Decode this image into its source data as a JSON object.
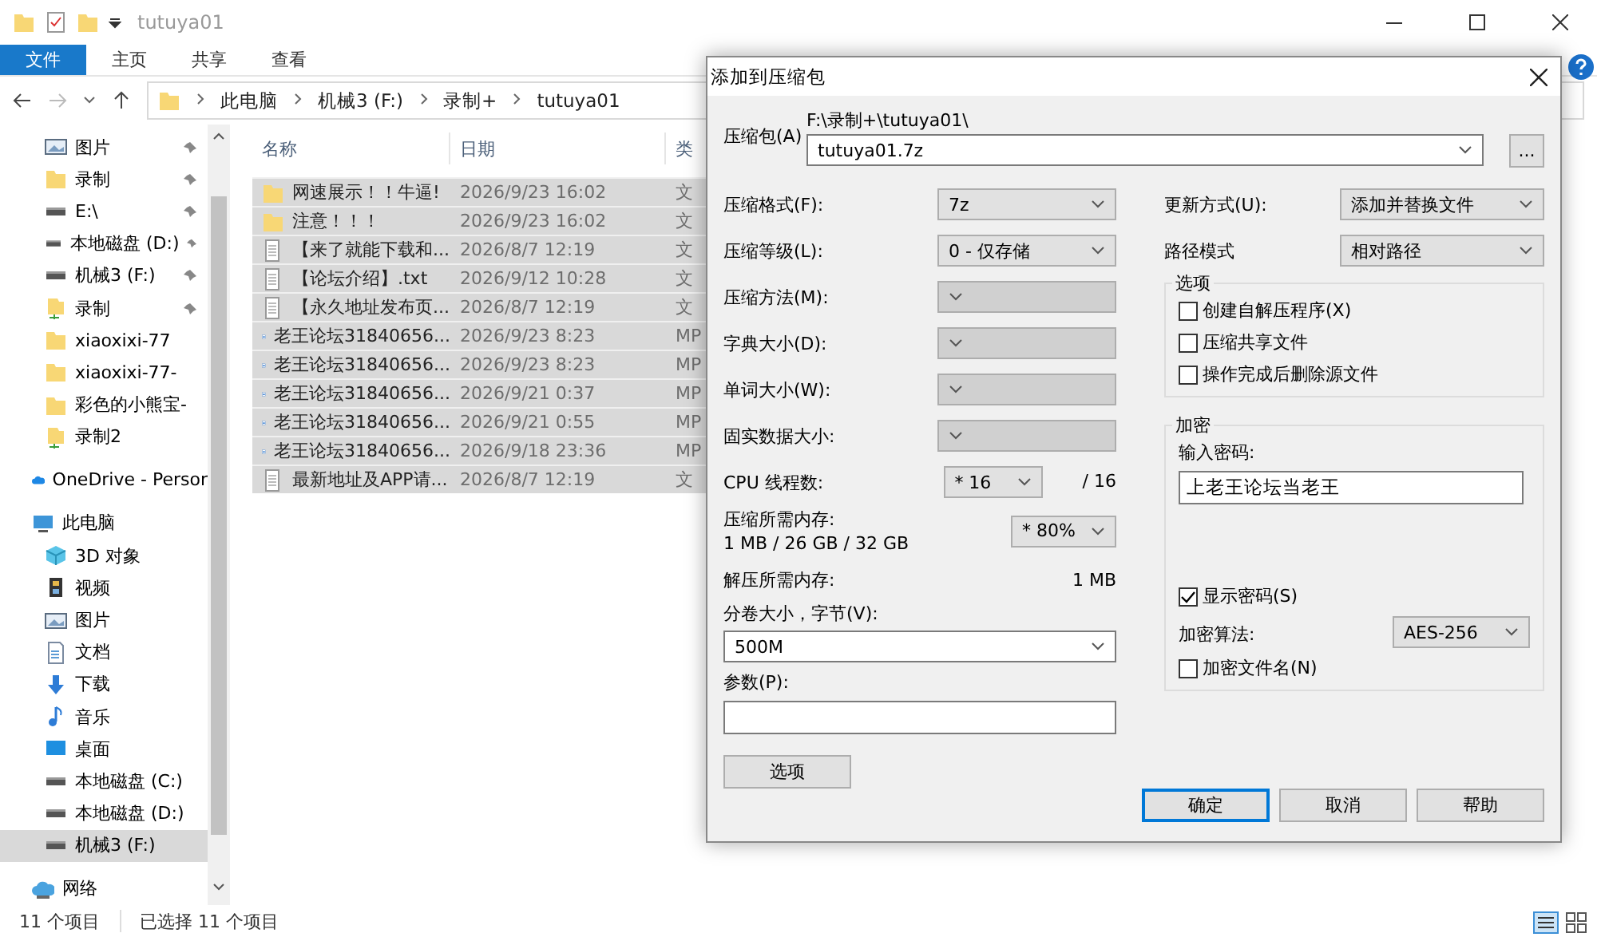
{
  "window": {
    "title": "tutuya01"
  },
  "ribbon_tabs": [
    {
      "label": "文件",
      "selected": true
    },
    {
      "label": "主页",
      "selected": false
    },
    {
      "label": "共享",
      "selected": false
    },
    {
      "label": "查看",
      "selected": false
    }
  ],
  "breadcrumb": [
    "此电脑",
    "机械3 (F:)",
    "录制+",
    "tutuya01"
  ],
  "nav_pane": {
    "quick_access": [
      {
        "label": "图片",
        "kind": "pictures",
        "pinned": true,
        "selected": false
      },
      {
        "label": "录制",
        "kind": "folder",
        "pinned": true,
        "selected": false
      },
      {
        "label": "E:\\",
        "kind": "drive",
        "pinned": true,
        "selected": false
      },
      {
        "label": "本地磁盘 (D:)",
        "kind": "drive",
        "pinned": true,
        "selected": false
      },
      {
        "label": "机械3 (F:)",
        "kind": "drive",
        "pinned": true,
        "selected": false
      },
      {
        "label": "录制",
        "kind": "share",
        "pinned": true,
        "selected": false
      },
      {
        "label": "xiaoxixi-77",
        "kind": "folder",
        "pinned": false,
        "selected": false
      },
      {
        "label": "xiaoxixi-77-",
        "kind": "folder",
        "pinned": false,
        "selected": false
      },
      {
        "label": "彩色的小熊宝-",
        "kind": "folder",
        "pinned": false,
        "selected": false
      },
      {
        "label": "录制2",
        "kind": "share",
        "pinned": false,
        "selected": false
      }
    ],
    "roots": [
      {
        "label": "OneDrive - Persor",
        "kind": "cloud",
        "selected": false
      },
      {
        "label": "此电脑",
        "kind": "pc",
        "selected": false,
        "children": [
          {
            "label": "3D 对象",
            "kind": "cube",
            "selected": false
          },
          {
            "label": "视频",
            "kind": "film",
            "selected": false
          },
          {
            "label": "图片",
            "kind": "pictures",
            "selected": false
          },
          {
            "label": "文档",
            "kind": "document",
            "selected": false
          },
          {
            "label": "下载",
            "kind": "download",
            "selected": false
          },
          {
            "label": "音乐",
            "kind": "music",
            "selected": false
          },
          {
            "label": "桌面",
            "kind": "desktop",
            "selected": false
          },
          {
            "label": "本地磁盘 (C:)",
            "kind": "drive",
            "selected": false
          },
          {
            "label": "本地磁盘 (D:)",
            "kind": "drive",
            "selected": false
          },
          {
            "label": "机械3 (F:)",
            "kind": "drive",
            "selected": true
          }
        ]
      },
      {
        "label": "网络",
        "kind": "network",
        "selected": false
      }
    ]
  },
  "file_list": {
    "columns": [
      "名称",
      "日期",
      "类"
    ],
    "rows": [
      {
        "name": "网速展示！！牛逼!",
        "date": "2026/9/23 16:02",
        "type": "文",
        "kind": "folder",
        "selected": true
      },
      {
        "name": "注意！！！",
        "date": "2026/9/23 16:02",
        "type": "文",
        "kind": "folder",
        "selected": true
      },
      {
        "name": "【来了就能下载和...",
        "date": "2026/8/7 12:19",
        "type": "文",
        "kind": "text",
        "selected": true
      },
      {
        "name": "【论坛介绍】.txt",
        "date": "2026/9/12 10:28",
        "type": "文",
        "kind": "text",
        "selected": true
      },
      {
        "name": "【永久地址发布页...",
        "date": "2026/8/7 12:19",
        "type": "文",
        "kind": "text",
        "selected": true
      },
      {
        "name": "老王论坛31840656...",
        "date": "2026/9/23 8:23",
        "type": "MP",
        "kind": "video",
        "selected": true
      },
      {
        "name": "老王论坛31840656...",
        "date": "2026/9/23 8:23",
        "type": "MP",
        "kind": "video",
        "selected": true
      },
      {
        "name": "老王论坛31840656...",
        "date": "2026/9/21 0:37",
        "type": "MP",
        "kind": "video",
        "selected": true
      },
      {
        "name": "老王论坛31840656...",
        "date": "2026/9/21 0:55",
        "type": "MP",
        "kind": "video",
        "selected": true
      },
      {
        "name": "老王论坛31840656...",
        "date": "2026/9/18 23:36",
        "type": "MP",
        "kind": "video",
        "selected": true
      },
      {
        "name": "最新地址及APP请...",
        "date": "2026/8/7 12:19",
        "type": "文",
        "kind": "text",
        "selected": true
      }
    ]
  },
  "status_bar": {
    "count": "11 个项目",
    "selection": "已选择 11 个项目"
  },
  "dialog": {
    "title": "添加到压缩包",
    "archive": {
      "label": "压缩包(A)",
      "folder": "F:\\录制+\\tutuya01\\",
      "value": "tutuya01.7z",
      "browse": "..."
    },
    "left_selects": [
      {
        "label": "压缩格式(F):",
        "value": "7z",
        "disabled": false
      },
      {
        "label": "压缩等级(L):",
        "value": "0 - 仅存储",
        "disabled": false
      },
      {
        "label": "压缩方法(M):",
        "disabled": true
      },
      {
        "label": "字典大小(D):",
        "disabled": true
      },
      {
        "label": "单词大小(W):",
        "disabled": true
      },
      {
        "label": "固实数据大小:",
        "disabled": true
      }
    ],
    "cpu_threads": {
      "label": "CPU 线程数:",
      "value": "* 16",
      "total": "/ 16"
    },
    "compress_memory": {
      "label": "压缩所需内存:",
      "detail": "1 MB / 26 GB / 32 GB",
      "value": "* 80%"
    },
    "decompress_memory": {
      "label": "解压所需内存:",
      "value": "1 MB"
    },
    "volume_size": {
      "label": "分卷大小，字节(V):",
      "value": "500M"
    },
    "parameters": {
      "label": "参数(P):"
    },
    "options_button": "选项",
    "update_mode": {
      "label": "更新方式(U):",
      "value": "添加并替换文件"
    },
    "path_mode": {
      "label": "路径模式",
      "value": "相对路径"
    },
    "options_group": {
      "title": "选项",
      "checkboxes": [
        {
          "label": "创建自解压程序(X)",
          "checked": false
        },
        {
          "label": "压缩共享文件",
          "checked": false
        },
        {
          "label": "操作完成后删除源文件",
          "checked": false
        }
      ]
    },
    "encryption": {
      "title": "加密",
      "password_label": "输入密码:",
      "password": "上老王论坛当老王",
      "show_password": {
        "label": "显示密码(S)",
        "checked": true
      },
      "method": {
        "label": "加密算法:",
        "value": "AES-256"
      },
      "encrypt_names": {
        "label": "加密文件名(N)",
        "checked": false
      }
    },
    "buttons": [
      {
        "label": "确定",
        "default": true
      },
      {
        "label": "取消",
        "default": false
      },
      {
        "label": "帮助",
        "default": false
      }
    ]
  }
}
